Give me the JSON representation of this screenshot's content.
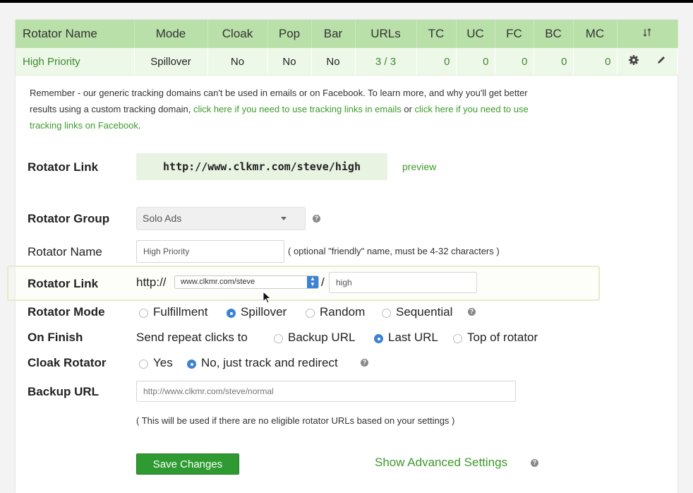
{
  "table": {
    "headers": [
      "Rotator Name",
      "Mode",
      "Cloak",
      "Pop",
      "Bar",
      "URLs",
      "TC",
      "UC",
      "FC",
      "BC",
      "MC"
    ],
    "sort_icon": "sort-icon",
    "row": {
      "name": "High Priority",
      "mode": "Spillover",
      "cloak": "No",
      "pop": "No",
      "bar": "No",
      "urls": "3 / 3",
      "tc": "0",
      "uc": "0",
      "fc": "0",
      "bc": "0",
      "mc": "0",
      "settings_icon": "gear-icon",
      "edit_icon": "pencil-icon"
    }
  },
  "notice": {
    "text1": "Remember - our generic tracking domains can't be used in emails or on Facebook. To learn more, and why you'll get better results using a custom tracking domain, ",
    "link1": "click here if you need to use tracking links in emails",
    "text2": " or ",
    "link2": "click here if you need to use tracking links on Facebook",
    "text3": "."
  },
  "rotator_link_display": {
    "label": "Rotator Link",
    "url": "http://www.clkmr.com/steve/high",
    "preview": "preview"
  },
  "group": {
    "label": "Rotator Group",
    "value": "Solo Ads"
  },
  "name_field": {
    "label": "Rotator Name",
    "value": "High Priority",
    "hint": "( optional \"friendly\" name, must be 4-32 characters )"
  },
  "link_field": {
    "label": "Rotator Link",
    "prefix": "http://",
    "domain": "www.clkmr.com/steve",
    "slash": "/",
    "slug": "high"
  },
  "mode": {
    "label": "Rotator Mode",
    "options": [
      "Fulfillment",
      "Spillover",
      "Random",
      "Sequential"
    ],
    "selected": "Spillover"
  },
  "on_finish": {
    "label": "On Finish",
    "prefix": "Send repeat clicks to",
    "options": [
      "Backup URL",
      "Last URL",
      "Top of rotator"
    ],
    "selected": "Last URL"
  },
  "cloak": {
    "label": "Cloak Rotator",
    "options": [
      "Yes",
      "No, just track and redirect"
    ],
    "selected": "No, just track and redirect"
  },
  "backup": {
    "label": "Backup URL",
    "placeholder": "http://www.clkmr.com/steve/normal",
    "hint": "( This will be used if there are no eligible rotator URLs based on your settings )"
  },
  "actions": {
    "save": "Save Changes",
    "advanced": "Show Advanced Settings"
  },
  "colors": {
    "header_green": "#b9e0a8",
    "row_green": "#eef8e9",
    "link_green": "#3d9a2a",
    "button_green": "#2f9a32",
    "radio_blue": "#3b82d6"
  }
}
